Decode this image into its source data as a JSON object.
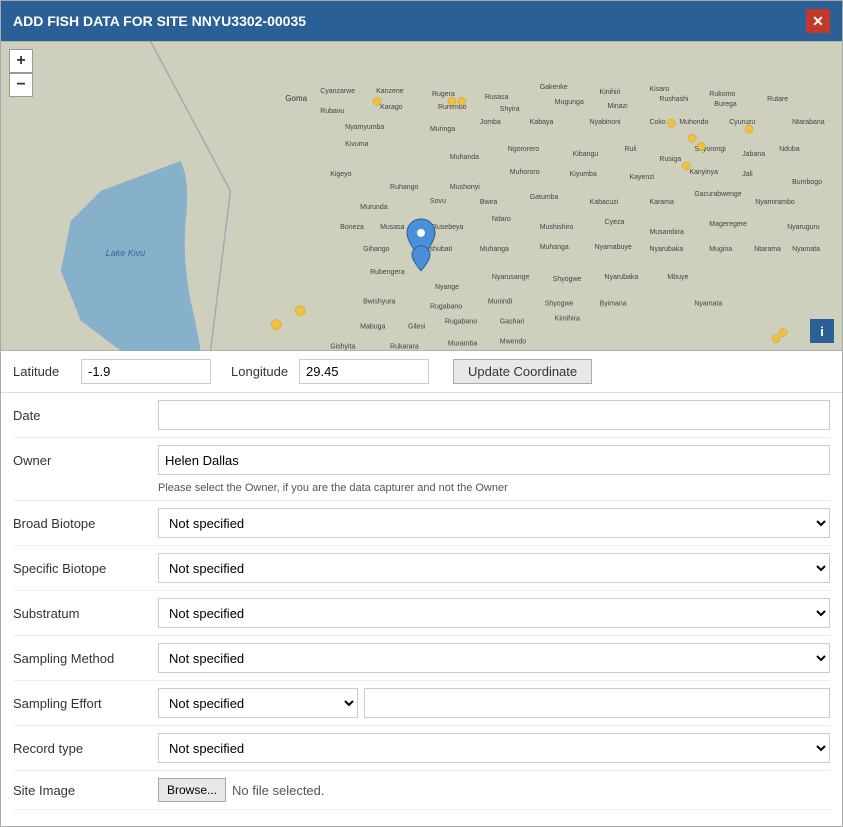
{
  "dialog": {
    "title": "ADD FISH DATA FOR SITE NNYU3302-00035",
    "close_label": "✕"
  },
  "map": {
    "zoom_in": "+",
    "zoom_out": "−",
    "info": "i"
  },
  "coords": {
    "lat_label": "Latitude",
    "lat_value": "-1.9",
    "lon_label": "Longitude",
    "lon_value": "29.45",
    "update_btn": "Update Coordinate"
  },
  "form": {
    "date_label": "Date",
    "date_placeholder": "",
    "owner_label": "Owner",
    "owner_value": "Helen Dallas",
    "owner_hint": "Please select the Owner, if you are the data capturer and not the Owner",
    "broad_biotope_label": "Broad Biotope",
    "broad_biotope_value": "Not specified",
    "specific_biotope_label": "Specific Biotope",
    "specific_biotope_value": "Not specified",
    "substratum_label": "Substratum",
    "substratum_value": "Not specified",
    "sampling_method_label": "Sampling Method",
    "sampling_method_value": "Not specified",
    "sampling_effort_label": "Sampling Effort",
    "sampling_effort_value": "Not specified",
    "record_type_label": "Record type",
    "record_type_value": "Not specified",
    "site_image_label": "Site Image",
    "browse_btn": "Browse...",
    "no_file": "No file selected.",
    "not_specified": "Not specified"
  },
  "dropdowns": {
    "not_specified_options": [
      "Not specified"
    ]
  }
}
